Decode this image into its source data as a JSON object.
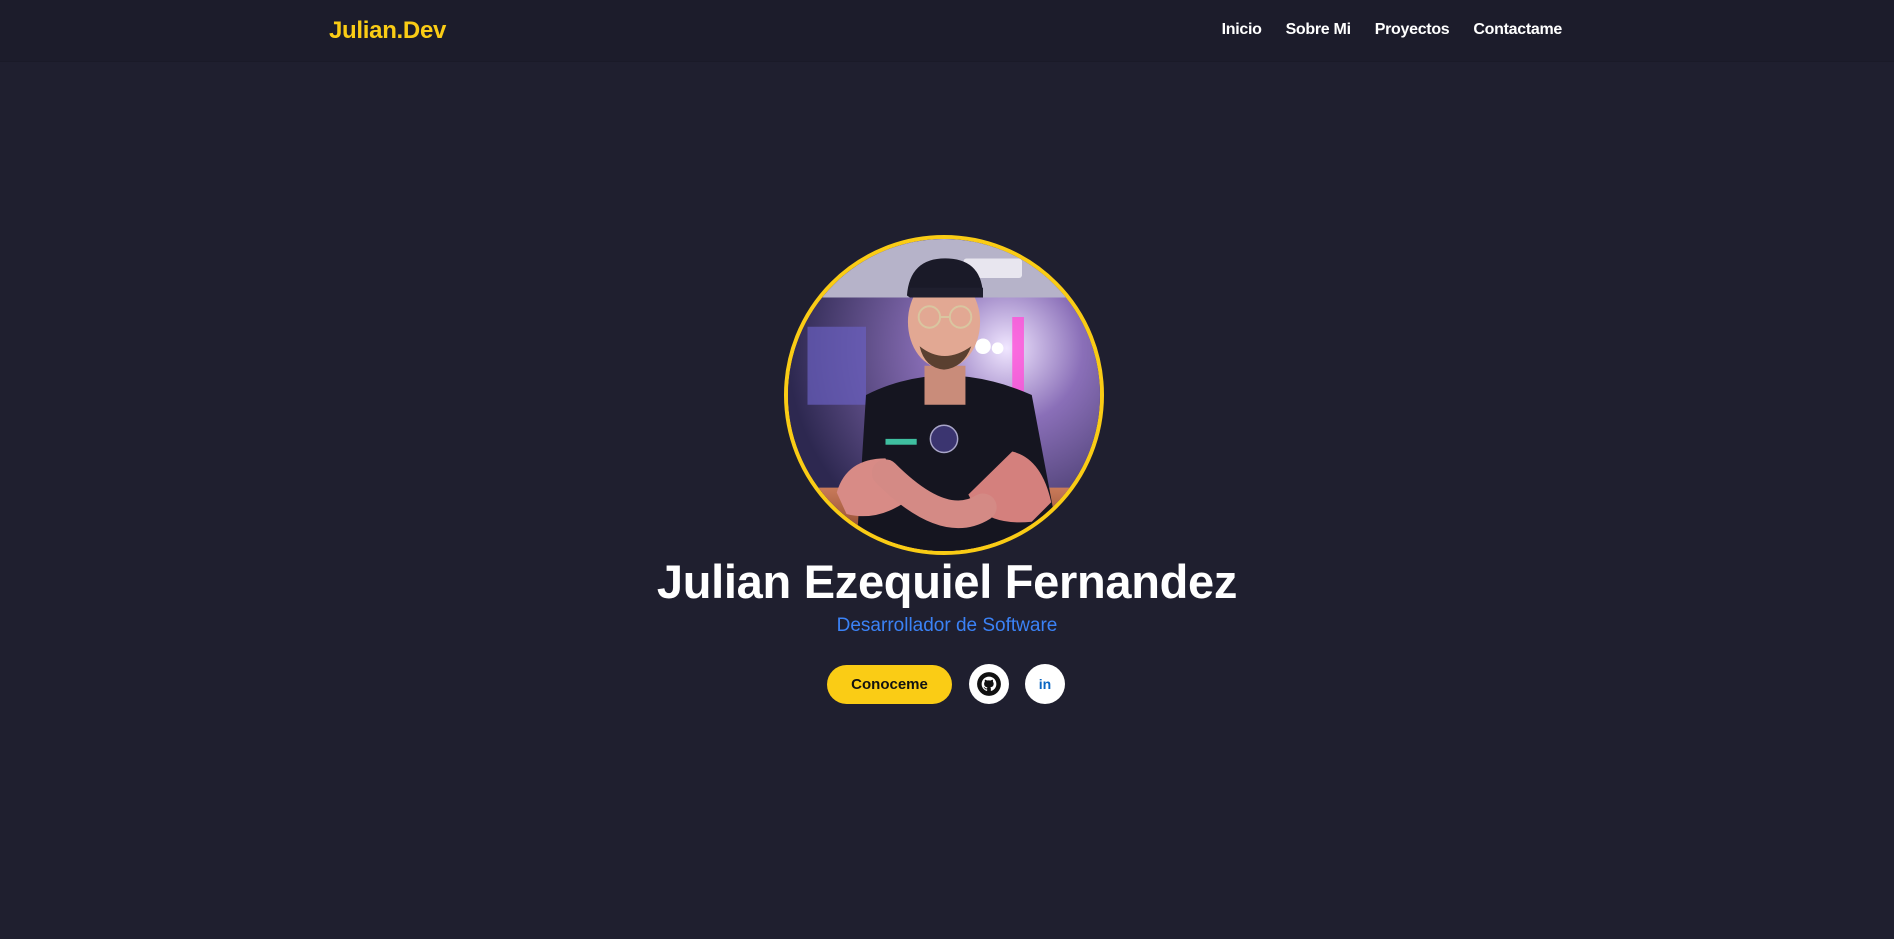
{
  "nav": {
    "brand": "Julian.Dev",
    "links": [
      "Inicio",
      "Sobre Mi",
      "Proyectos",
      "Contactame"
    ]
  },
  "hero": {
    "name": "Julian Ezequiel Fernandez",
    "role": "Desarrollador de Software",
    "cta_label": "Conoceme",
    "linkedin_label": "in"
  },
  "icons": {
    "github": "github-icon",
    "linkedin": "linkedin-icon"
  },
  "colors": {
    "background": "#1f1f2f",
    "accent": "#facc15",
    "role_text": "#3b82f6",
    "linkedin": "#0a66c2"
  }
}
